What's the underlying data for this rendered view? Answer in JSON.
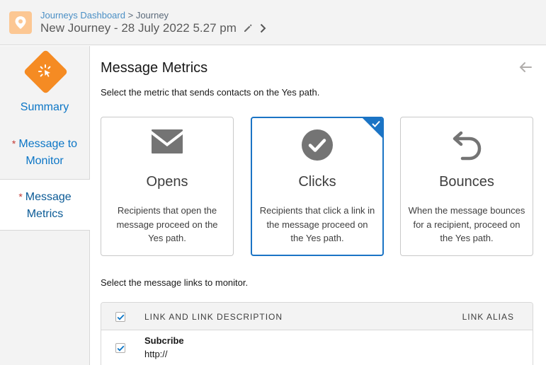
{
  "header": {
    "breadcrumb_link": "Journeys Dashboard",
    "breadcrumb_sep": ">",
    "breadcrumb_current": "Journey",
    "title": "New Journey - 28 July 2022 5.27 pm",
    "logo_icon": "location-pin-icon",
    "logo_color": "#fcc793"
  },
  "sidebar": {
    "summary_label": "Summary",
    "summary_icon": "click-burst-icon",
    "items": [
      {
        "required": "*",
        "line1": "Message to",
        "line2": "Monitor"
      },
      {
        "required": "*",
        "line1": "Message",
        "line2": "Metrics"
      }
    ]
  },
  "main": {
    "title": "Message Metrics",
    "instruction_metric": "Select the metric that sends contacts on the Yes path.",
    "cards": [
      {
        "icon": "envelope-icon",
        "title": "Opens",
        "desc": "Recipients that open the message proceed on the Yes path."
      },
      {
        "icon": "check-circle-icon",
        "title": "Clicks",
        "desc": "Recipients that click a link in the message proceed on the Yes path."
      },
      {
        "icon": "undo-arrow-icon",
        "title": "Bounces",
        "desc": "When the message bounces for a recipient, proceed on the Yes path."
      }
    ],
    "instruction_links": "Select the message links to monitor.",
    "table": {
      "col_link": "LINK AND LINK DESCRIPTION",
      "col_alias": "LINK ALIAS",
      "rows": [
        {
          "title": "Subcribe",
          "url": "http://"
        }
      ]
    }
  },
  "colors": {
    "accent": "#1b74c5",
    "link": "#0c76c6",
    "summary_diamond": "#f58b23",
    "required": "#c23934"
  }
}
